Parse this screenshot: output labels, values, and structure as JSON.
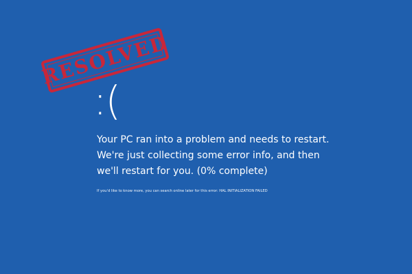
{
  "stamp": {
    "text": "RESOLVED",
    "color": "#c8273a"
  },
  "screen": {
    "background_color": "#1f5fae",
    "sad_face": ":(",
    "message": "Your PC ran into a problem and needs to restart. We're just collecting some error info, and then we'll restart for you. (0% complete)",
    "more_info": "If you'd like to know more, you can search online later for this error: HAL INITIALIZATION FAILED"
  }
}
